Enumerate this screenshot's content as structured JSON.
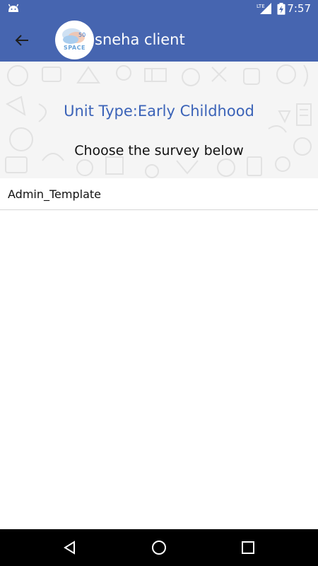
{
  "status_bar": {
    "time": "7:57",
    "network_label": "LTE",
    "icons": [
      "android-icon",
      "lte-signal-icon",
      "battery-charging-icon"
    ]
  },
  "app_bar": {
    "back_icon": "arrow-left-icon",
    "logo_text": "SPACE",
    "title": "sneha client",
    "color": "#4665b0"
  },
  "header": {
    "unit_type": "Unit Type:Early Childhood",
    "instruction": "Choose the survey below",
    "unit_type_color": "#3b63b8"
  },
  "survey_list": {
    "items": [
      {
        "label": "Admin_Template"
      }
    ]
  },
  "nav_bar": {
    "icons": [
      "nav-back-icon",
      "nav-home-icon",
      "nav-recents-icon"
    ]
  }
}
